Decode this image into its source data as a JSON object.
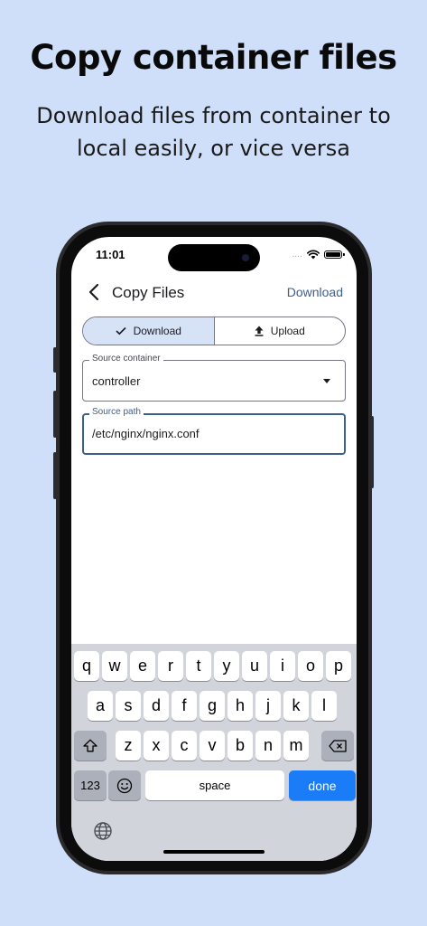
{
  "marketing": {
    "headline": "Copy container files",
    "subline": "Download files from container to local easily, or vice versa"
  },
  "status_bar": {
    "time": "11:01",
    "dots": "....",
    "icons": [
      "wifi-icon",
      "battery-icon"
    ]
  },
  "app_bar": {
    "title": "Copy Files",
    "action_label": "Download"
  },
  "mode_toggle": {
    "options": [
      {
        "label": "Download",
        "icon": "check-icon",
        "selected": true
      },
      {
        "label": "Upload",
        "icon": "upload-icon",
        "selected": false
      }
    ]
  },
  "form": {
    "source_container": {
      "label": "Source container",
      "value": "controller"
    },
    "source_path": {
      "label": "Source path",
      "value": "/etc/nginx/nginx.conf"
    }
  },
  "keyboard": {
    "row1": [
      "q",
      "w",
      "e",
      "r",
      "t",
      "y",
      "u",
      "i",
      "o",
      "p"
    ],
    "row2": [
      "a",
      "s",
      "d",
      "f",
      "g",
      "h",
      "j",
      "k",
      "l"
    ],
    "row3": [
      "z",
      "x",
      "c",
      "v",
      "b",
      "n",
      "m"
    ],
    "numbers_label": "123",
    "space_label": "space",
    "done_label": "done"
  },
  "colors": {
    "background": "#cfdff9",
    "accent": "#3d5f8e",
    "selected_segment": "#d6e3f7",
    "done_key": "#1a7cf6"
  }
}
